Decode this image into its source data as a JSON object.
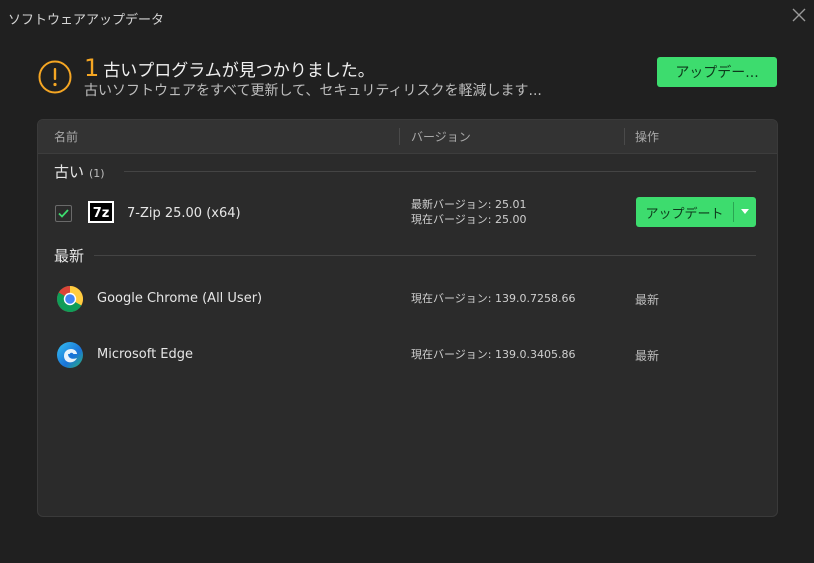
{
  "window": {
    "title": "ソフトウェアアップデータ"
  },
  "summary": {
    "count": "1",
    "message": "古いプログラムが見つかりました。",
    "subtitle": "古いソフトウェアをすべて更新して、セキュリティリスクを軽減します...",
    "update_all_label": "アップデー..."
  },
  "columns": {
    "name": "名前",
    "version": "バージョン",
    "action": "操作"
  },
  "groups": {
    "outdated": {
      "label": "古い",
      "count": "(1)",
      "items": [
        {
          "name": "7-Zip 25.00 (x64)",
          "icon": "7zip-icon",
          "latest_version": "最新バージョン: 25.01",
          "current_version": "現在バージョン: 25.00",
          "action_label": "アップデート",
          "checked": true
        }
      ]
    },
    "latest": {
      "label": "最新",
      "items": [
        {
          "name": "Google Chrome (All User)",
          "icon": "chrome-icon",
          "current_version": "現在バージョン: 139.0.7258.66",
          "status": "最新"
        },
        {
          "name": "Microsoft Edge",
          "icon": "edge-icon",
          "current_version": "現在バージョン: 139.0.3405.86",
          "status": "最新"
        }
      ]
    }
  },
  "colors": {
    "accent_green": "#3ddc6e",
    "warning_orange": "#f5a623",
    "background": "#202020"
  }
}
